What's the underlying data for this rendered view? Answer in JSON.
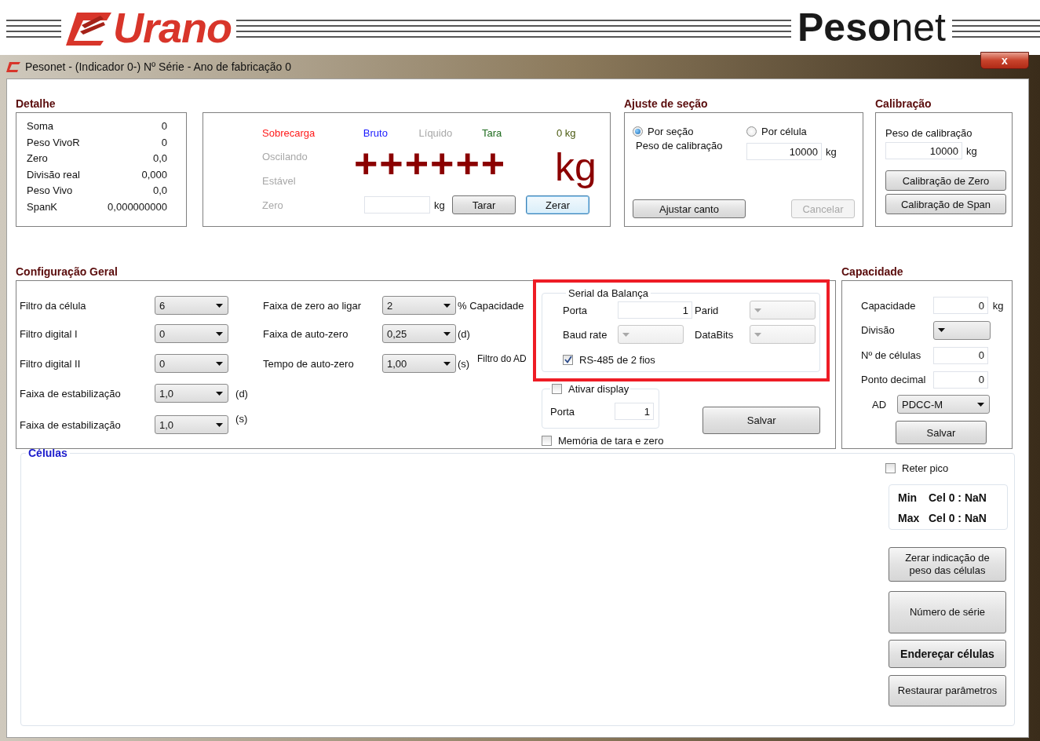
{
  "header": {
    "brand_left": "Urano",
    "brand_right": "**Peso**net"
  },
  "window": {
    "title": "Pesonet - (Indicador 0-) Nº Série  - Ano de fabricação 0",
    "close": "x"
  },
  "detalhe": {
    "title": "Detalhe",
    "rows": [
      {
        "label": "Soma",
        "value": "0"
      },
      {
        "label": "Peso VivoR",
        "value": "0"
      },
      {
        "label": "Zero",
        "value": "0,0"
      },
      {
        "label": "Divisão real",
        "value": "0,000"
      },
      {
        "label": "Peso Vivo",
        "value": "0,0"
      },
      {
        "label": "SpanK",
        "value": "0,000000000"
      }
    ]
  },
  "display": {
    "indicators": [
      {
        "label": "Sobrecarga",
        "color": "#ff1a1a"
      },
      {
        "label": "Bruto",
        "color": "#1a1aff"
      },
      {
        "label": "Líquido",
        "color": "#a8a8a8"
      },
      {
        "label": "Tara",
        "color": "#1e6b1e"
      },
      {
        "label": "0 kg",
        "color": "#4a5a10"
      }
    ],
    "states": [
      "Oscilando",
      "Estável",
      "Zero"
    ],
    "reading": "++++++",
    "unit": "kg",
    "tare_unit": "kg",
    "buttons": [
      {
        "label": "Tarar",
        "focused": false
      },
      {
        "label": "Zerar",
        "focused": true
      }
    ]
  },
  "ajuste": {
    "title": "Ajuste de seção",
    "options": [
      {
        "label": "Por seção",
        "selected": true
      },
      {
        "label": "Por célula",
        "selected": false
      }
    ],
    "weight_label": "Peso de calibração",
    "weight_value": "10000",
    "unit": "kg",
    "buttons": [
      {
        "label": "Ajustar canto",
        "disabled": false
      },
      {
        "label": "Cancelar",
        "disabled": true
      }
    ]
  },
  "calibracao": {
    "title": "Calibração",
    "weight_label": "Peso de calibração",
    "weight_value": "10000",
    "unit": "kg",
    "buttons": [
      "Calibração de Zero",
      "Calibração de Span"
    ]
  },
  "config": {
    "title": "Configuração Geral",
    "left": [
      {
        "label": "Filtro da célula",
        "value": "6"
      },
      {
        "label": "Filtro digital I",
        "value": "0"
      },
      {
        "label": "Filtro digital II",
        "value": "0"
      },
      {
        "label": "Faixa de estabilização",
        "value": "1,0",
        "unit": "(d)"
      },
      {
        "label": "Faixa de estabilização",
        "value": "1,0",
        "unit": "(s)"
      }
    ],
    "middle": [
      {
        "label": "Faixa de zero ao ligar",
        "value": "2",
        "unit": "% Capacidade"
      },
      {
        "label": "Faixa de auto-zero",
        "value": "0,25",
        "unit": "(d)"
      },
      {
        "label": "Tempo de auto-zero",
        "value": "1,00",
        "unit": "(s)"
      }
    ],
    "ad_filter_label": "Filtro do AD",
    "serial": {
      "title": "Serial da Balança",
      "fields": [
        {
          "label": "Porta",
          "kind": "text",
          "value": "1"
        },
        {
          "label": "Parid",
          "kind": "dropdown"
        },
        {
          "label": "Baud rate",
          "kind": "dropdown"
        },
        {
          "label": "DataBits",
          "kind": "dropdown"
        }
      ],
      "rs485": {
        "label": "RS-485 de 2 fios",
        "checked": true
      }
    },
    "display_group": {
      "label": "Ativar display",
      "checked": false,
      "port_label": "Porta",
      "port_value": "1"
    },
    "memory": {
      "label": "Memória de tara e zero",
      "checked": false
    },
    "save": "Salvar"
  },
  "capacidade": {
    "title": "Capacidade",
    "fields": [
      {
        "label": "Capacidade",
        "kind": "text",
        "value": "0",
        "unit": "kg"
      },
      {
        "label": "Divisão",
        "kind": "dropdown"
      },
      {
        "label": "Nº de células",
        "kind": "text",
        "value": "0"
      },
      {
        "label": "Ponto decimal",
        "kind": "text",
        "value": "0"
      },
      {
        "label": "AD",
        "kind": "dropdown",
        "value": "PDCC-M"
      }
    ],
    "save": "Salvar"
  },
  "celulas": {
    "title": "Células",
    "peak": {
      "label": "Reter pico",
      "checked": false
    },
    "stats": [
      {
        "label": "Min",
        "value": "Cel 0 : NaN"
      },
      {
        "label": "Max",
        "value": "Cel 0 : NaN"
      }
    ],
    "buttons": [
      {
        "label": "Zerar indicação de peso das células",
        "bold": false
      },
      {
        "label": "Número de série",
        "bold": false
      },
      {
        "label": "Endereçar células",
        "bold": true
      },
      {
        "label": "Restaurar parâmetros",
        "bold": false
      }
    ]
  }
}
